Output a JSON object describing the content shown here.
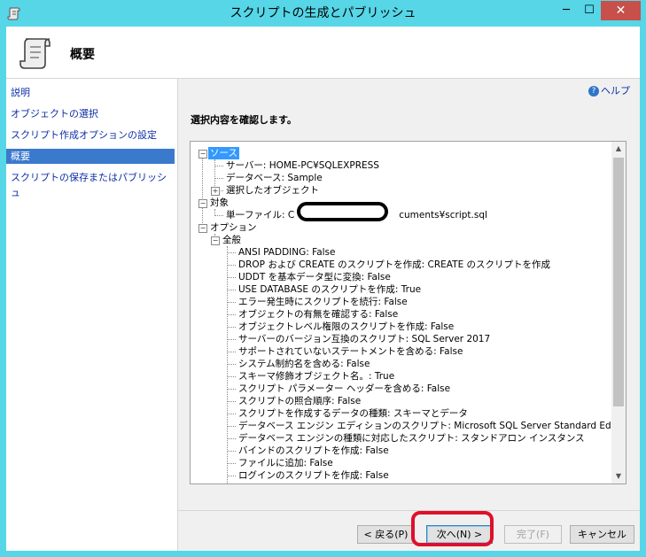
{
  "window": {
    "title": "スクリプトの生成とパブリッシュ",
    "minimize": "─",
    "maximize": "☐",
    "close": "✕",
    "accent": "#56d6e6"
  },
  "header": {
    "title": "概要"
  },
  "sidebar": {
    "items": [
      {
        "label": "説明"
      },
      {
        "label": "オブジェクトの選択"
      },
      {
        "label": "スクリプト作成オプションの設定"
      },
      {
        "label": "概要"
      },
      {
        "label": "スクリプトの保存またはパブリッシュ"
      }
    ],
    "selected_index": 3
  },
  "help": {
    "label": "ヘルプ"
  },
  "main": {
    "confirm_text": "選択内容を確認します。"
  },
  "tree": {
    "source": {
      "label": "ソース",
      "server": "サーバー: HOME-PC¥SQLEXPRESS",
      "database": "データベース: Sample",
      "selected_objects": "選択したオブジェクト"
    },
    "target": {
      "label": "対象",
      "file_prefix": "単一ファイル: C",
      "file_suffix": "cuments¥script.sql"
    },
    "options": {
      "label": "オプション",
      "general": "全般",
      "items": [
        "ANSI PADDING: False",
        "DROP および CREATE のスクリプトを作成: CREATE のスクリプトを作成",
        "UDDT を基本データ型に変換: False",
        "USE DATABASE のスクリプトを作成: True",
        "エラー発生時にスクリプトを続行: False",
        "オブジェクトの有無を確認する: False",
        "オブジェクトレベル権限のスクリプトを作成: False",
        "サーバーのバージョン互換のスクリプト: SQL Server 2017",
        "サポートされていないステートメントを含める: False",
        "システム制約名を含める: False",
        "スキーマ修飾オブジェクト名。: True",
        "スクリプト パラメーター ヘッダーを含める: False",
        "スクリプトの照合順序: False",
        "スクリプトを作成するデータの種類: スキーマとデータ",
        "データベース エンジン エディションのスクリプト: Microsoft SQL Server Standard Edition",
        "データベース エンジンの種類に対応したスクリプト: スタンドアロン インスタンス",
        "バインドのスクリプトを作成: False",
        "ファイルに追加: False",
        "ログインのスクリプトを作成: False"
      ]
    }
  },
  "buttons": {
    "back": "< 戻る(P)",
    "next": "次へ(N) >",
    "finish": "完了(F)",
    "cancel": "キャンセル"
  }
}
